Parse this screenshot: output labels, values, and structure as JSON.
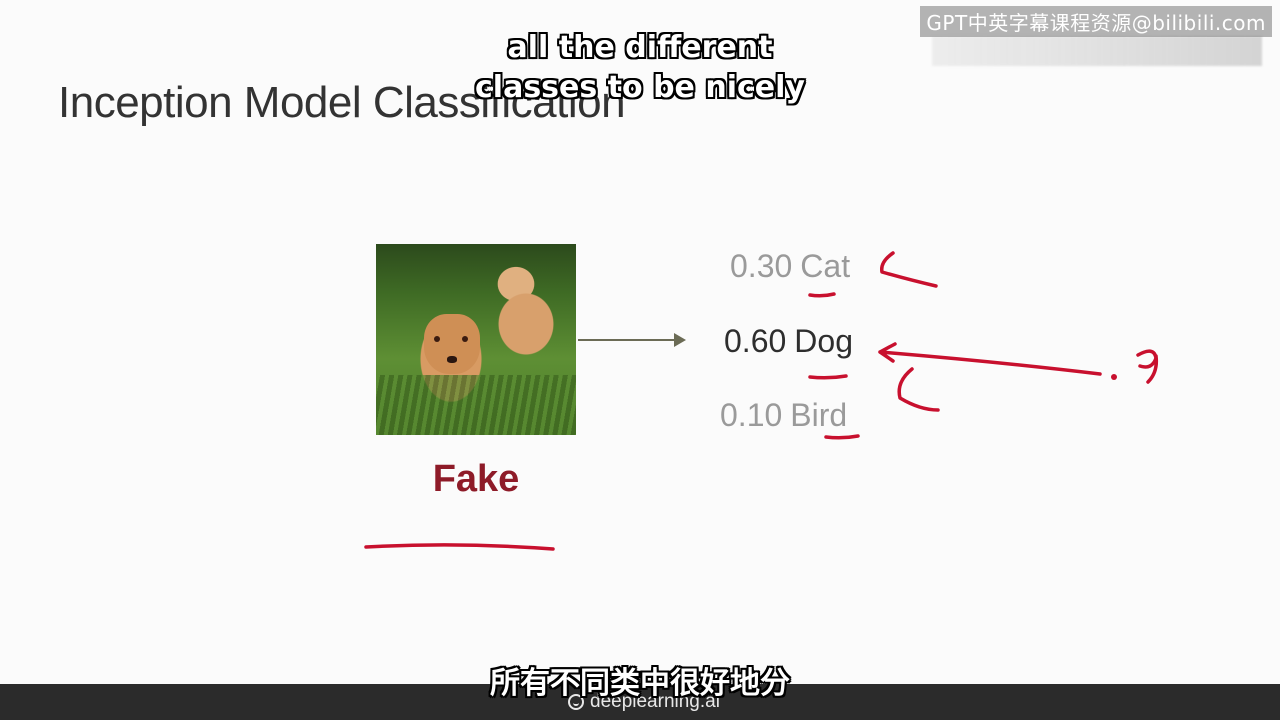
{
  "watermark": "GPT中英字幕课程资源@bilibili.com",
  "slide": {
    "title": "Inception Model Classification",
    "image_label": "Fake",
    "predictions": [
      {
        "score": "0.30",
        "label": "Cat",
        "emphasis": "dim"
      },
      {
        "score": "0.60",
        "label": "Dog",
        "emphasis": "active"
      },
      {
        "score": "0.10",
        "label": "Bird",
        "emphasis": "dim"
      }
    ],
    "annotation_text": ".9"
  },
  "subtitles": {
    "en_lines": [
      "all the different",
      "classes to be nicely"
    ],
    "zh": "所有不同类中很好地分"
  },
  "footer": {
    "logo_text": "deeplearning.ai"
  },
  "colors": {
    "verdict": "#8e1b28",
    "ink": "#c8102e",
    "arrow": "#6b6b55"
  }
}
